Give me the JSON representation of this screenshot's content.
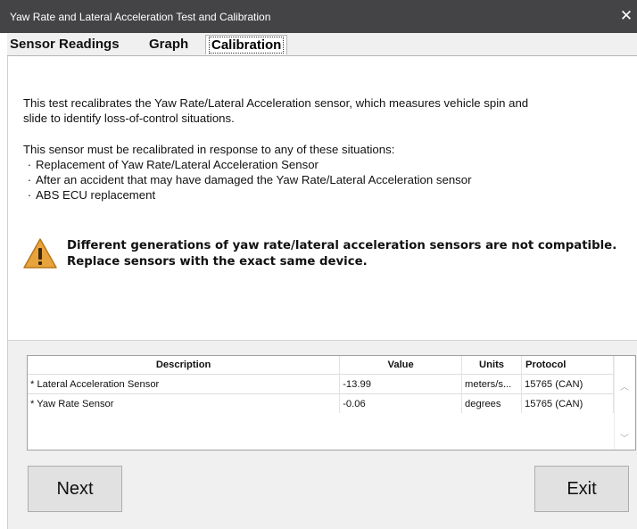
{
  "window": {
    "title": "Yaw Rate and Lateral Acceleration Test and Calibration",
    "close_glyph": "✕"
  },
  "tabs": [
    {
      "label": "Sensor Readings"
    },
    {
      "label": "Graph"
    },
    {
      "label": "Calibration",
      "active": true
    }
  ],
  "info": {
    "intro_line1": "This test recalibrates the Yaw Rate/Lateral Acceleration sensor, which measures vehicle spin and",
    "intro_line2": "slide to identify loss-of-control situations.",
    "situations_heading": "This sensor must be recalibrated in response to any of these situations:",
    "bullet_glyph": "·",
    "situations": [
      "Replacement of Yaw Rate/Lateral Acceleration Sensor",
      "After an accident that may have damaged the Yaw Rate/Lateral Acceleration sensor",
      "ABS ECU replacement"
    ],
    "warning_line1": "Different generations of yaw rate/lateral acceleration sensors are not compatible.",
    "warning_line2": "Replace sensors with the exact same device.",
    "warning_icon": "warning-triangle-icon",
    "warning_color": "#e8a33d"
  },
  "grid": {
    "headers": {
      "description": "Description",
      "value": "Value",
      "units": "Units",
      "protocol": "Protocol"
    },
    "rows": [
      {
        "description": "* Lateral Acceleration Sensor",
        "value": "-13.99",
        "units": "meters/s...",
        "protocol": "15765 (CAN)"
      },
      {
        "description": "* Yaw Rate Sensor",
        "value": "-0.06",
        "units": "degrees",
        "protocol": "15765 (CAN)"
      }
    ],
    "scroll_up_glyph": "︿",
    "scroll_down_glyph": "﹀"
  },
  "buttons": {
    "next": "Next",
    "exit": "Exit"
  }
}
